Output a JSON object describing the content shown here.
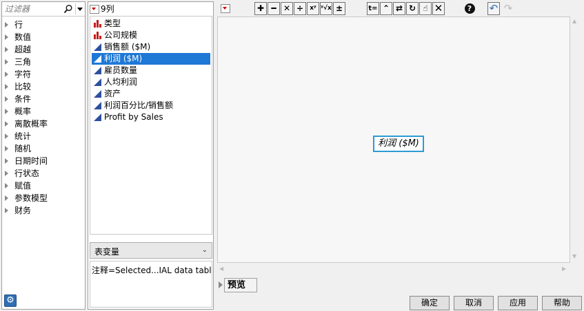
{
  "filter": {
    "placeholder": "过滤器"
  },
  "functions": [
    "行",
    "数值",
    "超越",
    "三角",
    "字符",
    "比较",
    "条件",
    "概率",
    "离散概率",
    "统计",
    "随机",
    "日期时间",
    "行状态",
    "赋值",
    "参数模型",
    "财务"
  ],
  "columns": {
    "header": "9列",
    "items": [
      {
        "label": "类型",
        "type": "nominal"
      },
      {
        "label": "公司规模",
        "type": "nominal"
      },
      {
        "label": "销售额 ($M)",
        "type": "continuous"
      },
      {
        "label": "利润 ($M)",
        "type": "continuous",
        "selected": true
      },
      {
        "label": "雇员数量",
        "type": "continuous"
      },
      {
        "label": "人均利润",
        "type": "continuous"
      },
      {
        "label": "资产",
        "type": "continuous"
      },
      {
        "label": "利润百分比/销售额",
        "type": "continuous"
      },
      {
        "label": "Profit by Sales",
        "type": "continuous"
      }
    ]
  },
  "var_select": {
    "value": "表变量"
  },
  "note": "注释=Selected...IAL data table.",
  "formula": {
    "expression": "利润 ($M)"
  },
  "toolbar_icons": [
    "add",
    "subtract",
    "multiply",
    "divide",
    "power",
    "root",
    "plus-minus",
    "assign",
    "up",
    "swap",
    "refresh",
    "pick",
    "clear",
    "help",
    "undo",
    "redo"
  ],
  "preview": {
    "label": "预览"
  },
  "buttons": {
    "ok": "确定",
    "cancel": "取消",
    "apply": "应用",
    "help": "帮助"
  },
  "colors": {
    "selection": "#1e78d6",
    "formula_border": "#2a9bd4",
    "nominal_icon": "#c61a1a",
    "continuous_icon": "#2d4fa0",
    "dropdown_red": "#d00000"
  }
}
